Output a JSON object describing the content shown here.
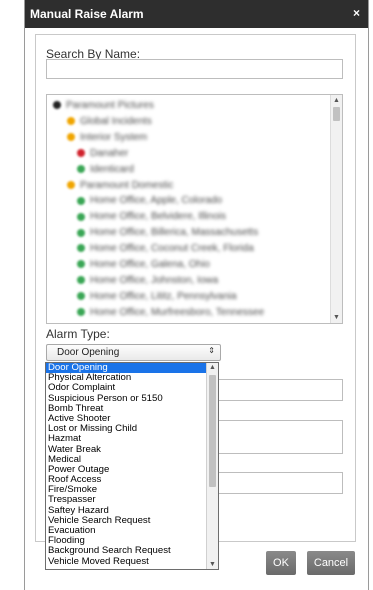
{
  "dialog": {
    "title": "Manual Raise Alarm",
    "close_glyph": "×"
  },
  "search": {
    "label": "Search By Name:",
    "value": ""
  },
  "tree": {
    "rows": [
      {
        "text": "Paramount Pictures",
        "icon": "black-dot-icon",
        "color": "#222222"
      },
      {
        "text": "Global Incidents",
        "icon": "orange-dot-icon",
        "color": "#f0a500"
      },
      {
        "text": "Interior System",
        "icon": "orange-dot-icon",
        "color": "#f0a500"
      },
      {
        "text": "Danaher",
        "icon": "red-dot-icon",
        "color": "#d0222c"
      },
      {
        "text": "Identicard",
        "icon": "green-dot-icon",
        "color": "#3aa655"
      },
      {
        "text": "Paramount Domestic",
        "icon": "orange-dot-icon",
        "color": "#f0a500"
      },
      {
        "text": "Home Office, Apple, Colorado",
        "icon": "green-dot-icon",
        "color": "#3aa655"
      },
      {
        "text": "Home Office, Belvidere, Illinois",
        "icon": "green-dot-icon",
        "color": "#3aa655"
      },
      {
        "text": "Home Office, Billerica, Massachusetts",
        "icon": "green-dot-icon",
        "color": "#3aa655"
      },
      {
        "text": "Home Office, Coconut Creek, Florida",
        "icon": "green-dot-icon",
        "color": "#3aa655"
      },
      {
        "text": "Home Office, Galena, Ohio",
        "icon": "green-dot-icon",
        "color": "#3aa655"
      },
      {
        "text": "Home Office, Johnston, Iowa",
        "icon": "green-dot-icon",
        "color": "#3aa655"
      },
      {
        "text": "Home Office, Lititz, Pennsylvania",
        "icon": "green-dot-icon",
        "color": "#3aa655"
      },
      {
        "text": "Home Office, Murfreesboro, Tennessee",
        "icon": "green-dot-icon",
        "color": "#3aa655"
      }
    ]
  },
  "alarm_type": {
    "label": "Alarm Type:",
    "selected": "Door Opening",
    "options": [
      "Door Opening",
      "Physical Altercation",
      "Odor Complaint",
      "Suspicious Person or 5150",
      "Bomb Threat",
      "Active Shooter",
      "Lost or Missing Child",
      "Hazmat",
      "Water Break",
      "Medical",
      "Power Outage",
      "Roof Access",
      "Fire/Smoke",
      "Trespasser",
      "Saftey Hazard",
      "Vehicle Search Request",
      "Evacuation",
      "Flooding",
      "Background Search Request",
      "Vehicle Moved Request"
    ]
  },
  "buttons": {
    "ok": "OK",
    "cancel": "Cancel"
  },
  "colors": {
    "titlebar": "#2e2e2e",
    "selected_option": "#1a73e8",
    "button": "#7a7a7a"
  }
}
